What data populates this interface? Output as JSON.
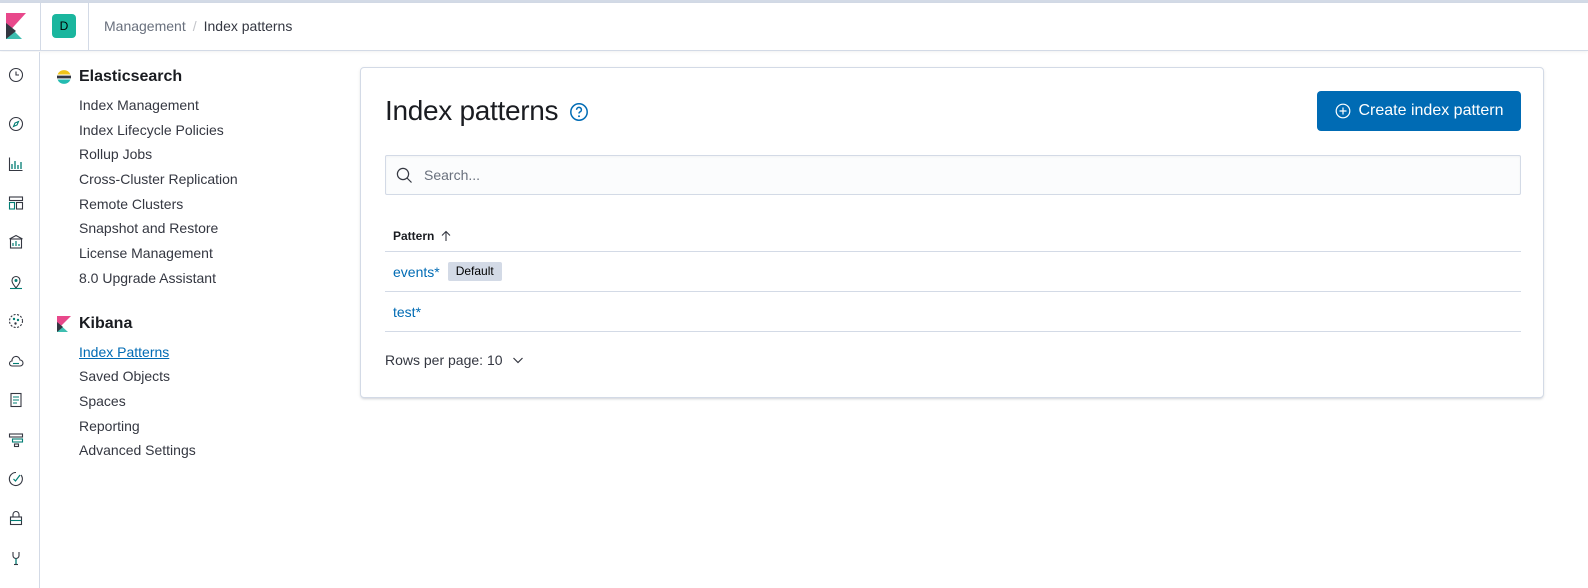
{
  "header": {
    "space_initial": "D",
    "breadcrumbs": [
      {
        "label": "Management"
      },
      {
        "label": "Index patterns"
      }
    ]
  },
  "sidenav": {
    "icons": [
      "recently-viewed-icon",
      "discover-icon",
      "visualize-icon",
      "dashboard-icon",
      "canvas-icon",
      "maps-icon",
      "ml-icon",
      "infrastructure-icon",
      "logs-icon",
      "apm-icon",
      "uptime-icon",
      "security-icon",
      "dev-tools-icon"
    ]
  },
  "menu": {
    "elasticsearch": {
      "title": "Elasticsearch",
      "items": [
        "Index Management",
        "Index Lifecycle Policies",
        "Rollup Jobs",
        "Cross-Cluster Replication",
        "Remote Clusters",
        "Snapshot and Restore",
        "License Management",
        "8.0 Upgrade Assistant"
      ]
    },
    "kibana": {
      "title": "Kibana",
      "items": [
        "Index Patterns",
        "Saved Objects",
        "Spaces",
        "Reporting",
        "Advanced Settings"
      ],
      "active": "Index Patterns"
    }
  },
  "main": {
    "title": "Index patterns",
    "create_button": "Create index pattern",
    "search_placeholder": "Search...",
    "table": {
      "column_header": "Pattern",
      "rows": [
        {
          "pattern": "events*",
          "badge": "Default"
        },
        {
          "pattern": "test*",
          "badge": ""
        }
      ]
    },
    "pagination": {
      "rows_per_page": "Rows per page: 10"
    }
  },
  "colors": {
    "accent": "#006bb4",
    "space_avatar": "#1ab69e"
  }
}
